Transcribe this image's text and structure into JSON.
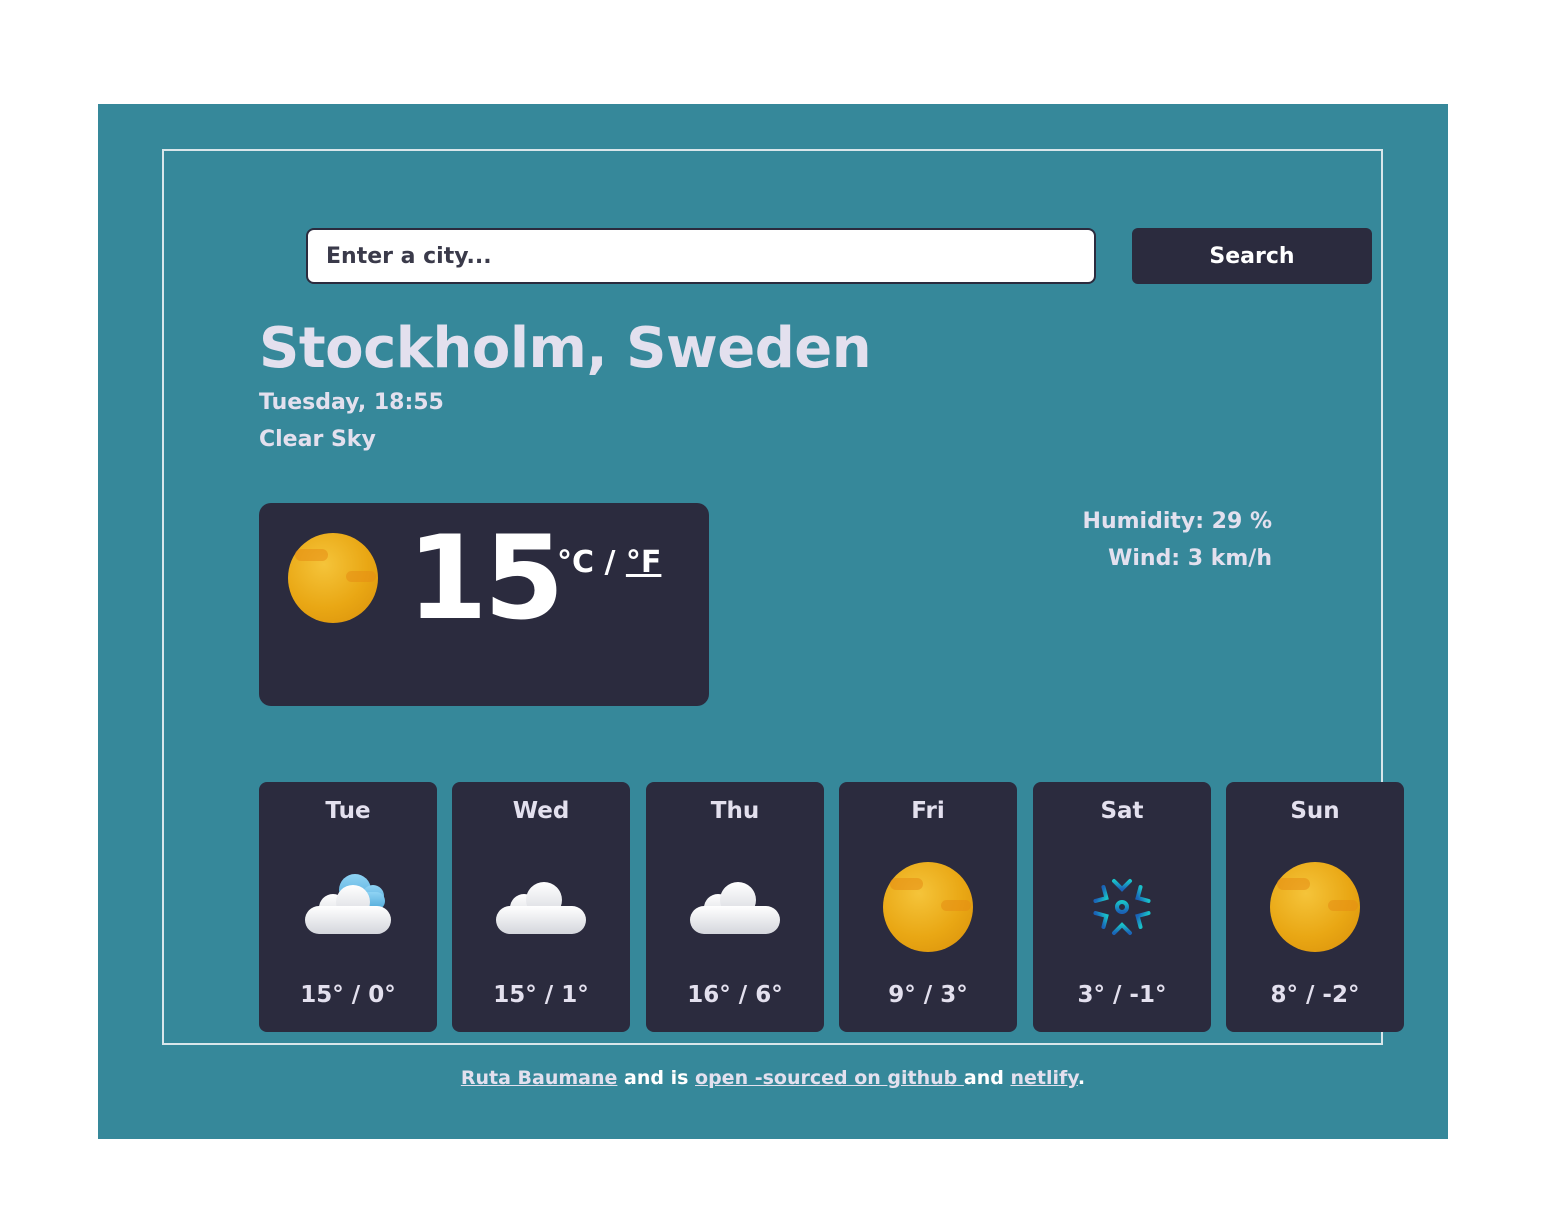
{
  "search": {
    "placeholder": "Enter a city...",
    "button_label": "Search"
  },
  "location": {
    "city": "Stockholm, Sweden",
    "datetime": "Tuesday, 18:55",
    "description": "Clear Sky"
  },
  "current": {
    "icon": "sun-icon",
    "temperature": "15",
    "unit_c": "°C",
    "separator": " / ",
    "unit_f": "°F"
  },
  "details": {
    "humidity": "Humidity: 29 %",
    "wind": "Wind: 3 km/h"
  },
  "forecast": [
    {
      "day": "Tue",
      "icon": "cloud-partly-icon",
      "temps": "15° / 0°"
    },
    {
      "day": "Wed",
      "icon": "cloud-icon",
      "temps": "15° / 1°"
    },
    {
      "day": "Thu",
      "icon": "cloud-icon",
      "temps": "16° / 6°"
    },
    {
      "day": "Fri",
      "icon": "sun-icon",
      "temps": "9° / 3°"
    },
    {
      "day": "Sat",
      "icon": "snowflake-icon",
      "temps": "3° / -1°"
    },
    {
      "day": "Sun",
      "icon": "sun-icon",
      "temps": "8° / -2°"
    }
  ],
  "footer": {
    "author_link": "Ruta Baumane",
    "text_1": " and is ",
    "github_link": "open -sourced on github ",
    "text_2": "and ",
    "netlify_link": "netlify",
    "text_3": "."
  },
  "colors": {
    "page_bg": "#ffffff",
    "app_bg": "#36889a",
    "card_bg": "#2b2b3e",
    "light_text": "#e3e0ee",
    "sun": "#e9a714",
    "snowflake": "#1aa3c8"
  }
}
